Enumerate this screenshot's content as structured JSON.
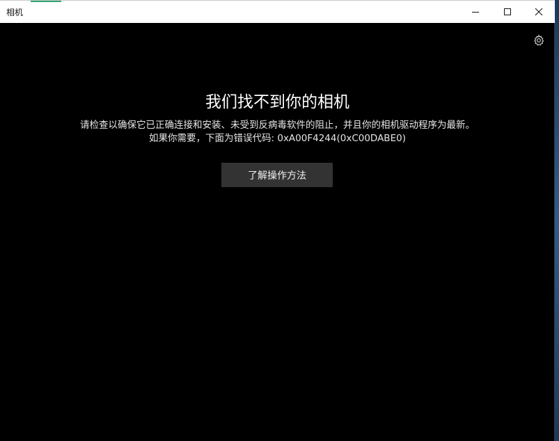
{
  "window": {
    "title": "相机"
  },
  "controls": {
    "minimize_icon": "minimize-icon",
    "maximize_icon": "maximize-icon",
    "close_icon": "close-icon",
    "settings_icon": "gear-icon"
  },
  "main": {
    "heading": "我们找不到你的相机",
    "description_line1": "请检查以确保它已正确连接和安装、未受到反病毒软件的阻止，并且你的相机驱动程序为最新。",
    "description_line2": "如果你需要，下面为错误代码: 0xA00F4244(0xC00DABE0)",
    "learn_button_label": "了解操作方法"
  },
  "colors": {
    "background": "#000000",
    "titlebar": "#ffffff",
    "button": "#333333",
    "text": "#ffffff"
  }
}
